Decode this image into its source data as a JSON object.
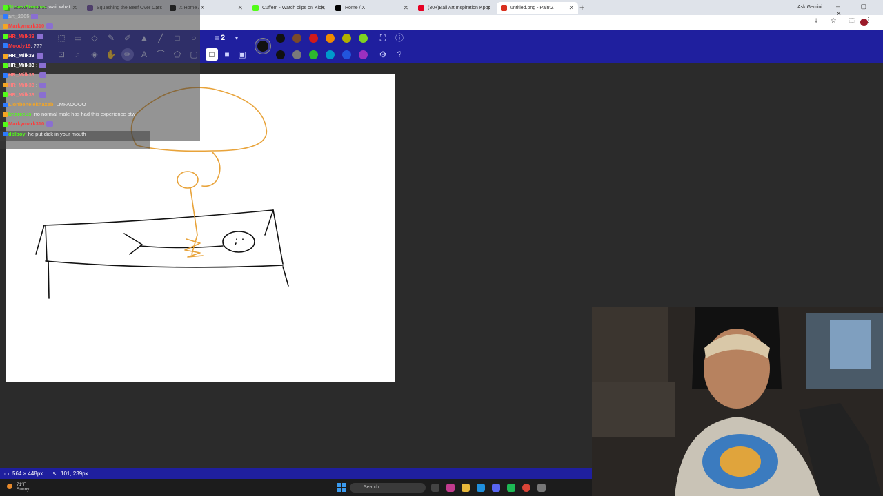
{
  "browser": {
    "tabs": [
      {
        "label": "StevenStreams",
        "color": "#53fc18"
      },
      {
        "label": "Squashing the Beef Over Cars",
        "color": "#6441a5"
      },
      {
        "label": "X Home / X",
        "color": "#000000"
      },
      {
        "label": "Cuffem - Watch clips on Kick",
        "color": "#53fc18"
      },
      {
        "label": "Home / X",
        "color": "#000000"
      },
      {
        "label": "(30+)Bali Art Inspiration Kpop",
        "color": "#e60023"
      },
      {
        "label": "untitled.png - PaintZ",
        "color": "#d9301f"
      }
    ],
    "new_tab": "+",
    "ask_gemini": "Ask Gemini",
    "window_controls": "–  ▢  ✕",
    "address_icons": "⤓ ☆ ⬚ ⋮"
  },
  "paint": {
    "brush_size": "2",
    "current_color": "#111111",
    "palette_row1": [
      "#111111",
      "#7b4a2a",
      "#d11a1a",
      "#f08a00",
      "#b0b000",
      "#7ed321"
    ],
    "palette_row2": [
      "#111111",
      "#7a7a7a",
      "#2db82d",
      "#0099cc",
      "#2255dd",
      "#9b30c0"
    ]
  },
  "chat": [
    {
      "user": "StevenStreams",
      "text": ": wait what",
      "color": "#53fc18"
    },
    {
      "user": "art_2005",
      "text": "",
      "color": "#c0c0c0"
    },
    {
      "user": "Markymark310",
      "text": "",
      "color": "#ff3b3b"
    },
    {
      "user": "HR_Milk33",
      "text": "",
      "color": "#ff3b3b"
    },
    {
      "user": "Moody19",
      "text": ": ???",
      "color": "#ff3b3b"
    },
    {
      "user": "HR_Milk33",
      "text": "",
      "color": "#ffffff"
    },
    {
      "user": "HR_Milk33",
      "text": " :",
      "color": "#ffffff"
    },
    {
      "user": "HR_Milk33",
      "text": " :",
      "color": "#ff8080"
    },
    {
      "user": "HR_Milk33",
      "text": " :",
      "color": "#ff8080"
    },
    {
      "user": "HR_Milk33",
      "text": " :",
      "color": "#ff8080"
    },
    {
      "user": "Lionbenelekhaxeb",
      "text": ": LMFAOOOO",
      "color": "#f5a623"
    },
    {
      "user": "krisreeus",
      "text": ": no normal male has had this experience btw",
      "color": "#53fc18"
    },
    {
      "user": "Markymark310",
      "text": "",
      "color": "#ff3b3b"
    },
    {
      "user": "dblboy",
      "text": ": he put dick in your mouth",
      "color": "#53fc18"
    }
  ],
  "status": {
    "canvas_size": "564 × 448px",
    "cursor_pos": "101, 239px"
  },
  "taskbar": {
    "weather_temp": "71°F",
    "weather_desc": "Sunny",
    "search_placeholder": "Search"
  }
}
